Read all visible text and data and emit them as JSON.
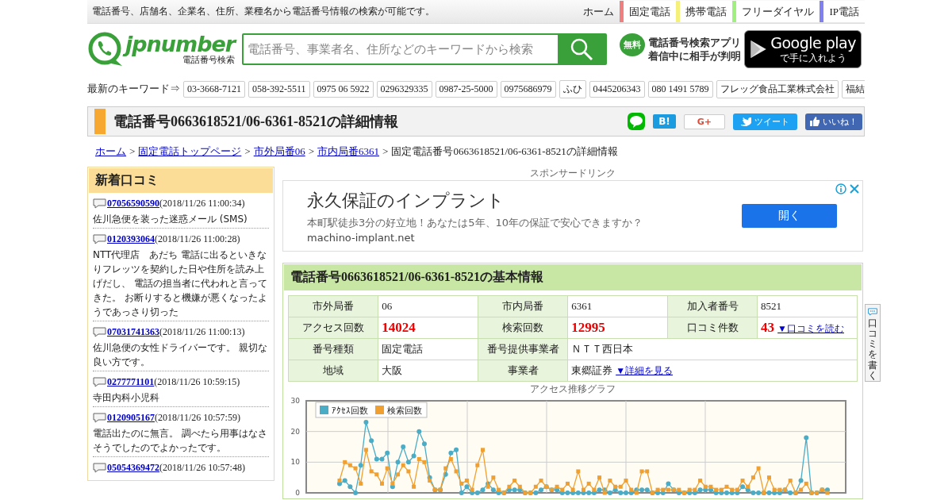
{
  "top_bar": {
    "tagline": "電話番号、店舗名、企業名、住所、業種名から電話番号情報の検索が可能です。",
    "nav": [
      {
        "label": "ホーム"
      },
      {
        "label": "固定電話",
        "color": "#f08080"
      },
      {
        "label": "携帯電話",
        "color": "#f5f07a"
      },
      {
        "label": "フリーダイヤル",
        "color": "#a0f080"
      },
      {
        "label": "IP電話",
        "color": "#8080f0"
      }
    ]
  },
  "header": {
    "logo_text": "jpnumber",
    "logo_sub": "電話番号検索",
    "search_placeholder": "電話番号、事業者名、住所などのキーワードから検索",
    "app_badge": "無料",
    "app_line1": "電話番号検索アプリ",
    "app_line2": "着信中に相手が判明",
    "store_title": "Google play",
    "store_sub": "で手に入れよう"
  },
  "keywords": {
    "label": "最新のキーワード⇒",
    "items": [
      "03-3668-7121",
      "058-392-5511",
      "0975 06 5922",
      "0296329335",
      "0987-25-5000",
      "0975686979",
      "ふひ",
      "0445206343",
      "080 1491 5789",
      "フレッグ食品工業株式会社",
      "福結"
    ]
  },
  "page_title": "電話番号0663618521/06-6361-8521の詳細情報",
  "share": {
    "hatena": "B!",
    "gplus": "G+",
    "tweet": "ツイート",
    "like": "いいね！"
  },
  "breadcrumb": {
    "separator": ">",
    "items": [
      {
        "label": "ホーム",
        "link": true
      },
      {
        "label": "固定電話トップページ",
        "link": true
      },
      {
        "label": "市外局番06",
        "link": true
      },
      {
        "label": "市内局番6361",
        "link": true
      },
      {
        "label": "固定電話番号0663618521/06-6361-8521の詳細情報",
        "link": false
      }
    ]
  },
  "sidebar": {
    "title": "新着口コミ",
    "items": [
      {
        "number": "07056590590",
        "date": "(2018/11/26 11:00:34)",
        "text": "佐川急便を装った迷惑メール (SMS)"
      },
      {
        "number": "0120393064",
        "date": "(2018/11/26 11:00:28)",
        "text": "NTT代理店　あだち 電話に出るといきなりフレッツを契約した日や住所を読み上げだし、 電話の担当者に代われと言ってきた。 お断りすると機嫌が悪くなったようであっさり切った"
      },
      {
        "number": "07031741363",
        "date": "(2018/11/26 11:00:13)",
        "text": "佐川急便の女性ドライバーです。 親切な良い方です。"
      },
      {
        "number": "0277771101",
        "date": "(2018/11/26 10:59:15)",
        "text": "寺田内科小児科"
      },
      {
        "number": "0120905167",
        "date": "(2018/11/26 10:57:59)",
        "text": "電話出たのに無言。 調べたら用事はなさそうでしたのでよかったです。"
      },
      {
        "number": "05054369472",
        "date": "(2018/11/26 10:57:48)"
      }
    ]
  },
  "ad": {
    "label": "スポンサードリンク",
    "headline": "永久保証のインプラント",
    "description": "本町駅徒歩3分の好立地！あなたは5年、10年の保証で安心できますか？",
    "url": "machino-implant.net",
    "button": "開く"
  },
  "info": {
    "title": "電話番号0663618521/06-6361-8521の基本情報",
    "rows": [
      [
        {
          "label": "市外局番",
          "value": "06",
          "kind": "text"
        },
        {
          "label": "市内局番",
          "value": "6361",
          "kind": "text"
        },
        {
          "label": "加入者番号",
          "value": "8521",
          "kind": "text"
        }
      ],
      [
        {
          "label": "アクセス回数",
          "value": "14024",
          "kind": "count"
        },
        {
          "label": "検索回数",
          "value": "12995",
          "kind": "count"
        },
        {
          "label": "口コミ件数",
          "value": "43",
          "kind": "count",
          "link": "▼口コミを読む"
        }
      ],
      [
        {
          "label": "番号種類",
          "value": "固定電話",
          "kind": "text"
        },
        {
          "label": "番号提供事業者",
          "value": "ＮＴＴ西日本",
          "kind": "text",
          "span": true
        }
      ],
      [
        {
          "label": "地域",
          "value": "大阪",
          "kind": "text"
        },
        {
          "label": "事業者",
          "value": "東郷証券",
          "kind": "text",
          "link": "▼詳細を見る",
          "span": true
        }
      ]
    ]
  },
  "chart": {
    "chart_data": {
      "type": "line",
      "title": "アクセス推移グラフ",
      "ylim": [
        0,
        30
      ],
      "yticks": [
        0,
        10,
        20,
        30
      ],
      "grid": true,
      "legend": true,
      "series": [
        {
          "name": "ｱｸｾｽ回数",
          "color": "#4bacc6",
          "marker": "circle",
          "values": [
            3,
            4,
            2,
            0,
            9,
            23,
            17,
            11,
            11,
            13,
            2,
            10,
            15,
            10,
            12,
            20,
            16,
            5,
            1,
            1,
            6,
            13,
            14,
            0,
            2,
            0,
            0,
            1,
            3,
            1,
            0,
            0,
            1,
            1,
            1,
            0,
            0,
            0,
            1,
            2,
            1,
            1,
            0,
            0,
            0,
            0,
            0,
            0,
            0,
            1,
            1,
            0,
            1,
            0,
            0,
            0,
            1,
            1,
            1,
            0,
            0,
            0,
            3,
            1,
            0,
            0,
            0,
            0,
            1,
            1,
            1,
            0,
            0,
            0,
            0,
            0,
            2,
            1,
            0,
            0,
            0,
            0,
            0,
            0,
            1,
            0,
            0,
            4,
            18,
            0,
            0,
            1,
            1
          ]
        },
        {
          "name": "検索回数",
          "color": "#f0a030",
          "marker": "square",
          "values": [
            4,
            10,
            9,
            8,
            3,
            14,
            7,
            6,
            3,
            8,
            3,
            6,
            9,
            7,
            2,
            11,
            10,
            4,
            1,
            1,
            8,
            11,
            7,
            3,
            4,
            1,
            9,
            14,
            2,
            5,
            1,
            0,
            2,
            4,
            2,
            0,
            0,
            2,
            4,
            2,
            1,
            2,
            1,
            3,
            1,
            7,
            1,
            3,
            1,
            5,
            0,
            4,
            2,
            2,
            4,
            1,
            0,
            7,
            7,
            0,
            1,
            1,
            1,
            1,
            1,
            0,
            1,
            1,
            4,
            2,
            2,
            1,
            1,
            2,
            1,
            1,
            4,
            2,
            5,
            8,
            0,
            5,
            1,
            1,
            1,
            4,
            0,
            1,
            3,
            0,
            0,
            1,
            0
          ]
        }
      ]
    }
  },
  "write_tab": "口コミを書く"
}
